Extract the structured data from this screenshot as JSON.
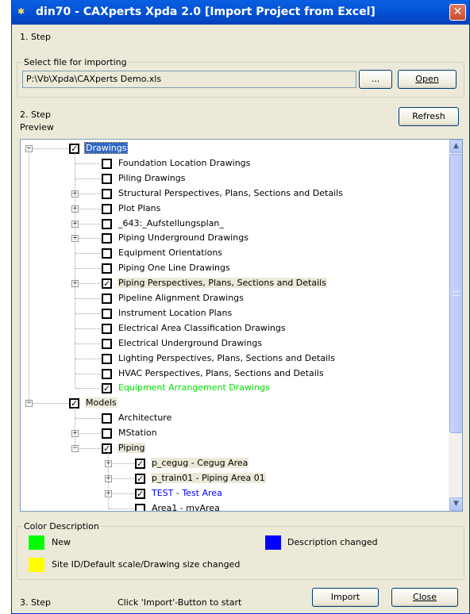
{
  "window": {
    "title": "din70 - CAXperts Xpda 2.0 [Import Project from Excel]",
    "close_glyph": "✕",
    "app_icon": "xpda-app-icon"
  },
  "step1": {
    "label": "1. Step",
    "group_label": "Select file for importing",
    "file_path": "P:\\Vb\\Xpda\\CAXperts Demo.xls",
    "browse_label": "...",
    "open_label": "Open"
  },
  "step2": {
    "label": "2. Step",
    "preview_label": "Preview",
    "refresh_label": "Refresh"
  },
  "tree": [
    {
      "label": "Drawings",
      "level": 0,
      "checked": true,
      "expander": "−",
      "style": "sel"
    },
    {
      "label": "Foundation Location Drawings",
      "level": 1,
      "checked": false,
      "expander": "",
      "style": ""
    },
    {
      "label": "Piling Drawings",
      "level": 1,
      "checked": false,
      "expander": "",
      "style": ""
    },
    {
      "label": "Structural Perspectives, Plans, Sections and Details",
      "level": 1,
      "checked": false,
      "expander": "+",
      "style": ""
    },
    {
      "label": "Plot Plans",
      "level": 1,
      "checked": false,
      "expander": "+",
      "style": ""
    },
    {
      "label": "_643:_Aufstellungsplan_",
      "level": 1,
      "checked": false,
      "expander": "+",
      "style": ""
    },
    {
      "label": "Piping Underground Drawings",
      "level": 1,
      "checked": false,
      "expander": "+",
      "style": ""
    },
    {
      "label": "Equipment Orientations",
      "level": 1,
      "checked": false,
      "expander": "",
      "style": ""
    },
    {
      "label": "Piping One Line Drawings",
      "level": 1,
      "checked": false,
      "expander": "",
      "style": ""
    },
    {
      "label": "Piping Perspectives, Plans, Sections and Details",
      "level": 1,
      "checked": true,
      "expander": "+",
      "style": "hl"
    },
    {
      "label": "Pipeline Alignment Drawings",
      "level": 1,
      "checked": false,
      "expander": "",
      "style": ""
    },
    {
      "label": "Instrument Location Plans",
      "level": 1,
      "checked": false,
      "expander": "",
      "style": ""
    },
    {
      "label": "Electrical Area Classification Drawings",
      "level": 1,
      "checked": false,
      "expander": "",
      "style": ""
    },
    {
      "label": "Electrical Underground Drawings",
      "level": 1,
      "checked": false,
      "expander": "",
      "style": ""
    },
    {
      "label": "Lighting Perspectives, Plans, Sections and Details",
      "level": 1,
      "checked": false,
      "expander": "",
      "style": ""
    },
    {
      "label": "HVAC Perspectives, Plans, Sections and Details",
      "level": 1,
      "checked": false,
      "expander": "",
      "style": ""
    },
    {
      "label": "Equipment Arrangement Drawings",
      "level": 1,
      "checked": true,
      "expander": "",
      "style": "green"
    },
    {
      "label": "Models",
      "level": 0,
      "checked": true,
      "expander": "−",
      "style": "hl"
    },
    {
      "label": "Architecture",
      "level": 1,
      "checked": false,
      "expander": "",
      "style": ""
    },
    {
      "label": "MStation",
      "level": 1,
      "checked": false,
      "expander": "+",
      "style": ""
    },
    {
      "label": "Piping",
      "level": 1,
      "checked": true,
      "expander": "−",
      "style": "hl"
    },
    {
      "label": "p_cegug - Cegug Area",
      "level": 2,
      "checked": true,
      "expander": "+",
      "style": "hl"
    },
    {
      "label": "p_train01 - Piping Area 01",
      "level": 2,
      "checked": true,
      "expander": "+",
      "style": "hl"
    },
    {
      "label": "TEST - Test Area",
      "level": 2,
      "checked": true,
      "expander": "+",
      "style": "blue"
    },
    {
      "label": "Area1 - myArea",
      "level": 2,
      "checked": false,
      "expander": "",
      "style": ""
    }
  ],
  "colors": {
    "group_label": "Color Description",
    "new_label": "New",
    "new_color": "#00ff00",
    "desc_label": "Description changed",
    "desc_color": "#0000ff",
    "site_label": "Site ID/Default scale/Drawing size changed",
    "site_color": "#ffff00"
  },
  "step3": {
    "label": "3. Step",
    "hint": "Click 'Import'-Button to start",
    "import_label": "Import",
    "close_label": "Close"
  }
}
